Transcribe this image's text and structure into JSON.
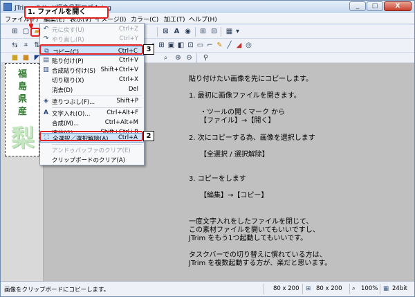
{
  "window": {
    "title": "JTrim - C:¥...¥福島県梨ロゴ１.jpg",
    "buttons": [
      "_",
      "□",
      "X"
    ]
  },
  "menubar": {
    "items": [
      {
        "label": "ファイル(F)"
      },
      {
        "label": "編集(E)"
      },
      {
        "label": "表示(V)"
      },
      {
        "label": "イメージ(I)"
      },
      {
        "label": "カラー(C)"
      },
      {
        "label": "加工(T)"
      },
      {
        "label": "ヘルプ(H)"
      }
    ]
  },
  "edit_menu": {
    "items": [
      {
        "icon": "undo-icon",
        "glyph": "↶",
        "label": "元に戻す(U)",
        "shortcut": "Ctrl+Z",
        "disabled": true
      },
      {
        "icon": "redo-icon",
        "glyph": "↷",
        "label": "やり直し(R)",
        "shortcut": "Ctrl+Y",
        "disabled": true
      },
      {
        "icon": "copy-icon",
        "glyph": "⧉",
        "label": "コピー(C)",
        "shortcut": "Ctrl+C",
        "highlight": true
      },
      {
        "icon": "paste-icon",
        "glyph": "▤",
        "label": "貼り付け(P)",
        "shortcut": "Ctrl+V"
      },
      {
        "icon": "paste-merge-icon",
        "glyph": "▥",
        "label": "合成貼り付け(S)",
        "shortcut": "Shift+Ctrl+V"
      },
      {
        "icon": "",
        "glyph": "",
        "label": "切り取り(X)",
        "shortcut": "Ctrl+X"
      },
      {
        "icon": "",
        "glyph": "",
        "label": "消去(D)",
        "shortcut": "Del"
      },
      {
        "icon": "fill-icon",
        "glyph": "◈",
        "label": "塗りつぶし(F)...",
        "shortcut": "Shift+P"
      },
      {
        "icon": "text-icon",
        "glyph": "A",
        "label": "文字入れ(O)...",
        "shortcut": "Ctrl+Alt+F"
      },
      {
        "icon": "",
        "glyph": "",
        "label": "合成(M)...",
        "shortcut": "Ctrl+Alt+M"
      },
      {
        "icon": "",
        "glyph": "",
        "label": "連結(G)...",
        "shortcut": "Shift+Ctrl+B"
      },
      {
        "icon": "select-all-icon",
        "glyph": "⛶",
        "label": "全選択／選択解除(A)",
        "shortcut": "Ctrl+A",
        "highlight": true
      },
      {
        "icon": "",
        "glyph": "",
        "label": "アンドゥバッファのクリア(E)",
        "shortcut": "",
        "disabled": true
      },
      {
        "icon": "",
        "glyph": "",
        "label": "クリップボードのクリア(A)",
        "shortcut": ""
      }
    ]
  },
  "callouts": {
    "step1_label": "1. ファイルを開く",
    "step2": "2",
    "step3": "3"
  },
  "image_text": {
    "kanji": [
      "福",
      "島",
      "県",
      "産"
    ],
    "big": "梨"
  },
  "instructions": [
    "貼り付けたい画像を先にコピーします。",
    "1. 最初に画像ファイルを開きます。",
    "・ツールの開くマーク から",
    "【ファイル】→【開く】",
    "2. 次にコピーする為、画像を選択します",
    "【全選択 / 選択解除】",
    "3. コピーをします",
    "【編集】→【コピー】",
    "一度文字入れをしたファイルを閉じて、",
    "この素材ファイルを開いてもいいですし、",
    "JTrim をもう1つ起動してもいいです。",
    "タスクバーでの切り替えに慣れている方は、",
    "JTrim を複数起動する方が、楽だと思います。"
  ],
  "status": {
    "message": "画像をクリップボードにコピーします。",
    "size1": "80 x 200",
    "size2": "80 x 200",
    "zoom": "100%",
    "depth": "24bit"
  },
  "colors": {
    "callout": "#e02020",
    "highlight": "#cfe3fb",
    "kanji": "#2e7a2e",
    "canvas": "#c0c0c0"
  }
}
